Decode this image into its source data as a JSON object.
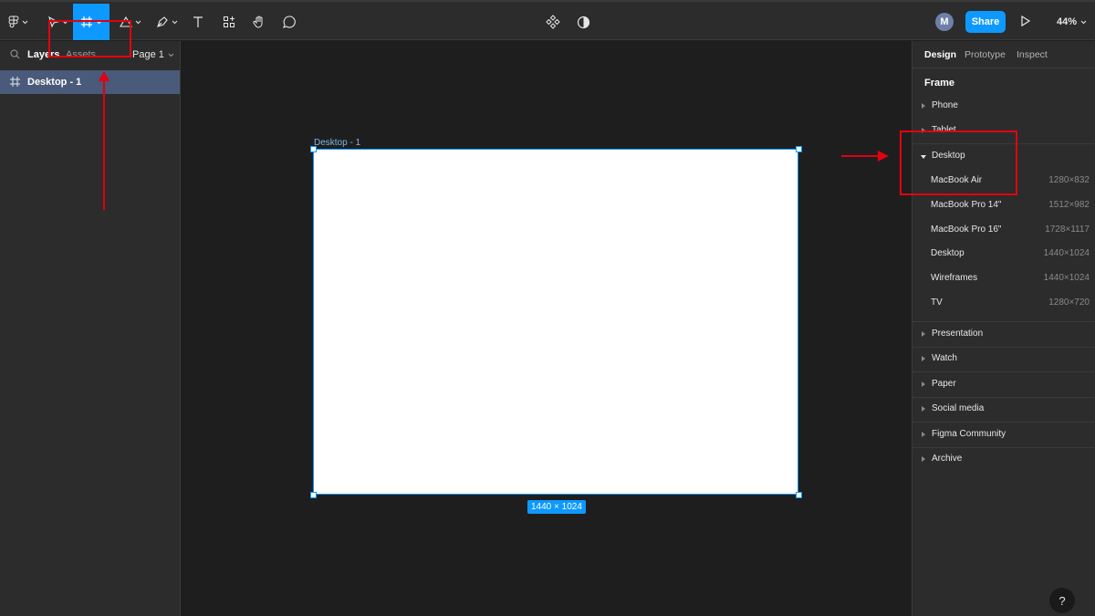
{
  "toolbar": {
    "tools": [
      {
        "name": "figma-menu-icon"
      },
      {
        "name": "move-tool-icon"
      },
      {
        "name": "frame-tool-icon",
        "active": true
      },
      {
        "name": "shape-tool-icon"
      },
      {
        "name": "pen-tool-icon"
      },
      {
        "name": "text-tool-icon"
      },
      {
        "name": "resources-icon"
      },
      {
        "name": "hand-tool-icon"
      },
      {
        "name": "comment-tool-icon"
      }
    ],
    "center_icons": [
      "component-icon",
      "contrast-icon"
    ],
    "avatar_initial": "M",
    "share_label": "Share",
    "zoom": "44%",
    "accent": "#0d99ff"
  },
  "left_panel": {
    "tab_layers": "Layers",
    "tab_assets": "Assets",
    "page": "Page 1",
    "layers": [
      {
        "label": "Desktop - 1",
        "selected": true
      }
    ]
  },
  "canvas": {
    "frame_title": "Desktop - 1",
    "dimensions": "1440 × 1024"
  },
  "right_panel": {
    "tabs": [
      "Design",
      "Prototype",
      "Inspect"
    ],
    "active_tab": "Design",
    "section_title": "Frame",
    "categories_top": [
      {
        "label": "Phone",
        "expanded": false
      },
      {
        "label": "Tablet",
        "expanded": false
      },
      {
        "label": "Desktop",
        "expanded": true
      }
    ],
    "desktop_presets": [
      {
        "name": "MacBook Air",
        "size": "1280×832"
      },
      {
        "name": "MacBook Pro 14\"",
        "size": "1512×982"
      },
      {
        "name": "MacBook Pro 16\"",
        "size": "1728×1117"
      },
      {
        "name": "Desktop",
        "size": "1440×1024"
      },
      {
        "name": "Wireframes",
        "size": "1440×1024"
      },
      {
        "name": "TV",
        "size": "1280×720"
      }
    ],
    "categories_bottom": [
      {
        "label": "Presentation"
      },
      {
        "label": "Watch"
      },
      {
        "label": "Paper"
      },
      {
        "label": "Social media"
      },
      {
        "label": "Figma Community"
      },
      {
        "label": "Archive"
      }
    ]
  },
  "help_label": "?",
  "annotation_color": "#e3000f"
}
